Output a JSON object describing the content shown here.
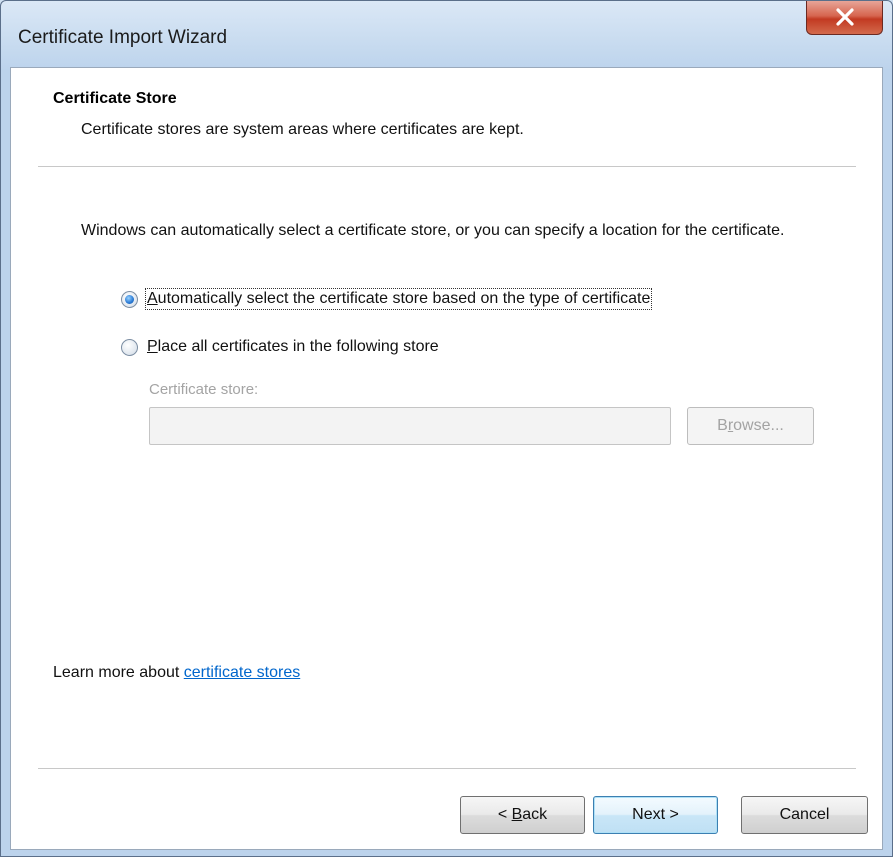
{
  "window": {
    "title": "Certificate Import Wizard",
    "close_icon": "close-icon"
  },
  "header": {
    "title": "Certificate Store",
    "subtitle": "Certificate stores are system areas where certificates are kept."
  },
  "body": {
    "description": "Windows can automatically select a certificate store, or you can specify a location for the certificate.",
    "options": [
      {
        "prefix": "",
        "accel": "A",
        "rest": "utomatically select the certificate store based on the type of certificate",
        "selected": true
      },
      {
        "prefix": "",
        "accel": "P",
        "rest": "lace all certificates in the following store",
        "selected": false
      }
    ],
    "store_label": "Certificate store:",
    "store_value": "",
    "browse_prefix": "B",
    "browse_accel": "r",
    "browse_rest": "owse...",
    "learn_more_text": "Learn more about ",
    "learn_more_link": "certificate stores"
  },
  "footer": {
    "back_prefix": "< ",
    "back_accel": "B",
    "back_rest": "ack",
    "next_label": "Next >",
    "cancel_label": "Cancel"
  },
  "colors": {
    "link": "#0066cc",
    "close_button": "#c23a22",
    "default_button_border": "#3c7fb1"
  }
}
